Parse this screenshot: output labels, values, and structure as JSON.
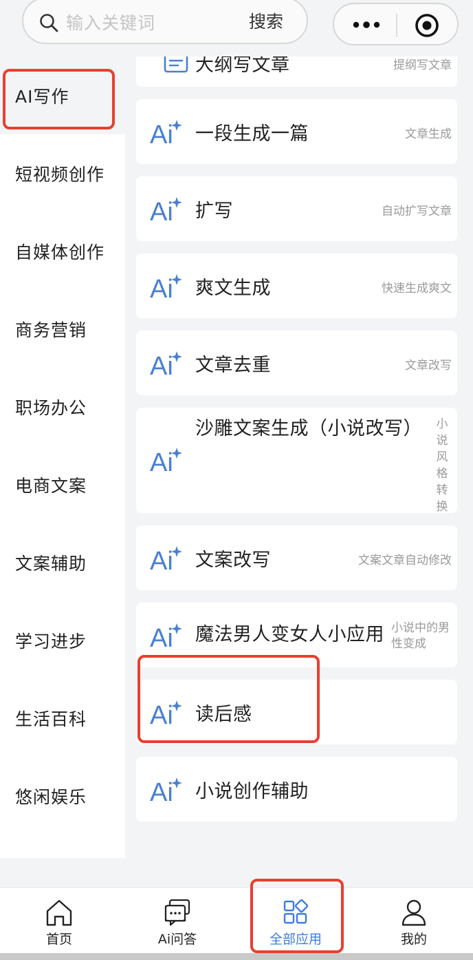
{
  "search": {
    "placeholder": "输入关键词",
    "button_label": "搜索"
  },
  "capsule": {
    "more_icon": "more-dots-icon",
    "close_icon": "target-circle-icon"
  },
  "sidebar": {
    "items": [
      {
        "label": "AI写作",
        "active": true
      },
      {
        "label": "短视频创作"
      },
      {
        "label": "自媒体创作"
      },
      {
        "label": "商务营销"
      },
      {
        "label": "职场办公"
      },
      {
        "label": "电商文案"
      },
      {
        "label": "文案辅助"
      },
      {
        "label": "学习进步"
      },
      {
        "label": "生活百科"
      },
      {
        "label": "悠闲娱乐"
      }
    ]
  },
  "tools": {
    "partial_top": {
      "title": "大纲写文章",
      "subtitle": "提纲写文章"
    },
    "items": [
      {
        "title": "一段生成一篇",
        "subtitle": "文章生成"
      },
      {
        "title": "扩写",
        "subtitle": "自动扩写文章"
      },
      {
        "title": "爽文生成",
        "subtitle": "快速生成爽文"
      },
      {
        "title": "文章去重",
        "subtitle": "文章改写"
      },
      {
        "title": "沙雕文案生成（小说改写）",
        "subtitle": "小说风格转换"
      },
      {
        "title": "文案改写",
        "subtitle": "文案文章自动修改"
      },
      {
        "title": "魔法男人变女人小应用",
        "subtitle": "小说中的男性变成"
      },
      {
        "title": "读后感",
        "subtitle": ""
      },
      {
        "title": "小说创作辅助",
        "subtitle": ""
      }
    ]
  },
  "tabbar": {
    "tabs": [
      {
        "label": "首页",
        "icon": "home-icon"
      },
      {
        "label": "Ai问答",
        "icon": "chat-icon"
      },
      {
        "label": "全部应用",
        "icon": "apps-grid-icon",
        "active": true
      },
      {
        "label": "我的",
        "icon": "user-icon"
      }
    ]
  },
  "colors": {
    "accent": "#3c7ce0",
    "highlight": "#e8402e",
    "ai_icon": "#4a7fd0"
  }
}
